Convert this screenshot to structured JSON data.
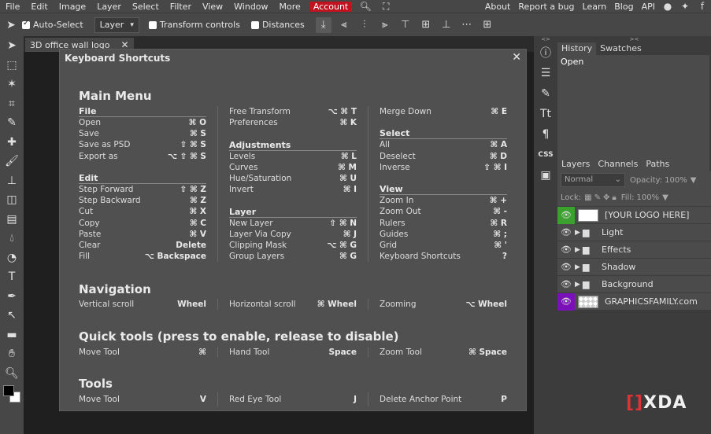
{
  "menubar": {
    "items": [
      "File",
      "Edit",
      "Image",
      "Layer",
      "Select",
      "Filter",
      "View",
      "Window",
      "More"
    ],
    "account": "Account",
    "right_items": [
      "About",
      "Report a bug",
      "Learn",
      "Blog",
      "API"
    ]
  },
  "optbar": {
    "auto_select_label": "Auto-Select",
    "layer_select_value": "Layer",
    "transform_controls_label": "Transform controls",
    "distances_label": "Distances"
  },
  "doc_tab": {
    "title": "3D office wall logo"
  },
  "dialog": {
    "title": "Keyboard Shortcuts",
    "main_menu": {
      "heading": "Main Menu",
      "file": {
        "title": "File",
        "rows": [
          {
            "label": "Open",
            "key": "⌘ O"
          },
          {
            "label": "Save",
            "key": "⌘ S"
          },
          {
            "label": "Save as PSD",
            "key": "⇧ ⌘ S"
          },
          {
            "label": "Export as",
            "key": "⌥ ⇧ ⌘ S"
          }
        ]
      },
      "edit": {
        "title": "Edit",
        "rows": [
          {
            "label": "Step Forward",
            "key": "⇧ ⌘ Z"
          },
          {
            "label": "Step Backward",
            "key": "⌘ Z"
          },
          {
            "label": "Cut",
            "key": "⌘ X"
          },
          {
            "label": "Copy",
            "key": "⌘ C"
          },
          {
            "label": "Paste",
            "key": "⌘ V"
          },
          {
            "label": "Clear",
            "key": "Delete"
          },
          {
            "label": "Fill",
            "key": "⌥ Backspace"
          }
        ]
      },
      "misc": {
        "rows": [
          {
            "label": "Free Transform",
            "key": "⌥ ⌘ T"
          },
          {
            "label": "Preferences",
            "key": "⌘ K"
          }
        ]
      },
      "adjustments": {
        "title": "Adjustments",
        "rows": [
          {
            "label": "Levels",
            "key": "⌘ L"
          },
          {
            "label": "Curves",
            "key": "⌘ M"
          },
          {
            "label": "Hue/Saturation",
            "key": "⌘ U"
          },
          {
            "label": "Invert",
            "key": "⌘ I"
          }
        ]
      },
      "layer": {
        "title": "Layer",
        "rows": [
          {
            "label": "New Layer",
            "key": "⇧ ⌘ N"
          },
          {
            "label": "Layer Via Copy",
            "key": "⌘ J"
          },
          {
            "label": "Clipping Mask",
            "key": "⌥ ⌘ G"
          },
          {
            "label": "Group Layers",
            "key": "⌘ G"
          }
        ]
      },
      "merge": {
        "rows": [
          {
            "label": "Merge Down",
            "key": "⌘ E"
          }
        ]
      },
      "select": {
        "title": "Select",
        "rows": [
          {
            "label": "All",
            "key": "⌘ A"
          },
          {
            "label": "Deselect",
            "key": "⌘ D"
          },
          {
            "label": "Inverse",
            "key": "⇧ ⌘ I"
          }
        ]
      },
      "view": {
        "title": "View",
        "rows": [
          {
            "label": "Zoom In",
            "key": "⌘ +"
          },
          {
            "label": "Zoom Out",
            "key": "⌘ -"
          },
          {
            "label": "Rulers",
            "key": "⌘ R"
          },
          {
            "label": "Guides",
            "key": "⌘ ;"
          },
          {
            "label": "Grid",
            "key": "⌘ '"
          },
          {
            "label": "Keyboard Shortcuts",
            "key": "?"
          }
        ]
      }
    },
    "navigation": {
      "heading": "Navigation",
      "rows": [
        {
          "label": "Vertical scroll",
          "key": "Wheel"
        },
        {
          "label": "Horizontal scroll",
          "key": "⌘ Wheel"
        },
        {
          "label": "Zooming",
          "key": "⌥ Wheel"
        }
      ]
    },
    "quick_tools": {
      "heading": "Quick tools (press to enable, release to disable)",
      "rows": [
        {
          "label": "Move Tool",
          "key": "⌘"
        },
        {
          "label": "Hand Tool",
          "key": "Space"
        },
        {
          "label": "Zoom Tool",
          "key": "⌘ Space"
        }
      ]
    },
    "tools": {
      "heading": "Tools",
      "rows": [
        {
          "label": "Move Tool",
          "key": "V"
        },
        {
          "label": "Red Eye Tool",
          "key": "J"
        },
        {
          "label": "Delete Anchor Point",
          "key": "P"
        }
      ]
    }
  },
  "history_panel": {
    "tabs": [
      "History",
      "Swatches"
    ],
    "items": [
      "Open"
    ]
  },
  "layers_panel": {
    "tabs": [
      "Layers",
      "Channels",
      "Paths"
    ],
    "blend_mode": "Normal",
    "opacity_label": "Opacity:",
    "opacity_value": "100%",
    "lock_label": "Lock:",
    "fill_label": "Fill:",
    "fill_value": "100%",
    "layers": [
      {
        "name": "[YOUR LOGO HERE]",
        "type": "smart"
      },
      {
        "name": "Light",
        "type": "folder"
      },
      {
        "name": "Effects",
        "type": "folder"
      },
      {
        "name": "Shadow",
        "type": "folder"
      },
      {
        "name": "Background",
        "type": "folder"
      },
      {
        "name": "GRAPHICSFAMILY.com",
        "type": "image"
      }
    ]
  },
  "watermark": {
    "brand": "XDA"
  },
  "colors": {
    "account": "#c1121f",
    "layer_visible_active": "#3aa02e",
    "layer_visible_bottom": "#7a10b8"
  }
}
